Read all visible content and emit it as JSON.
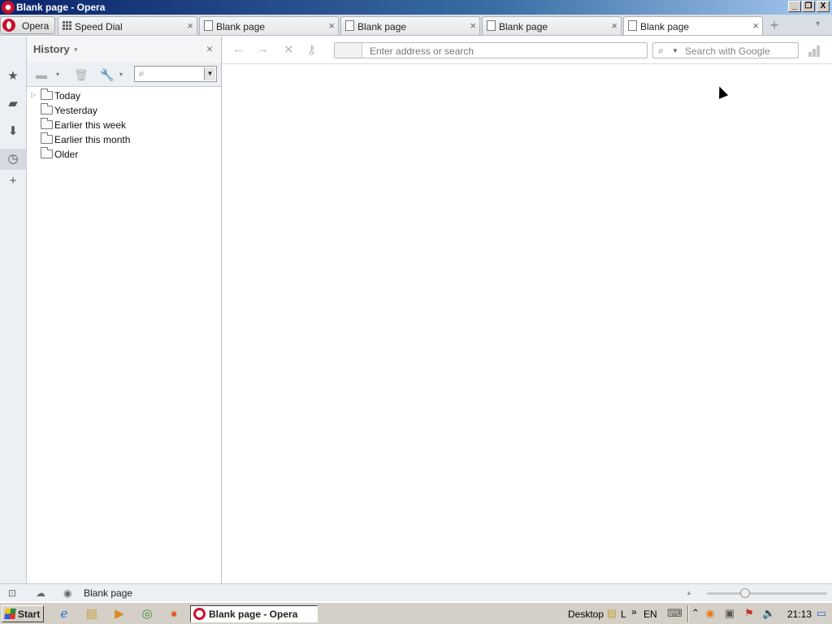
{
  "window": {
    "title": "Blank page - Opera",
    "buttons": [
      "_",
      "❐",
      "X"
    ]
  },
  "tabstrip": {
    "menu_label": "Opera",
    "tabs": [
      {
        "label": "Speed Dial",
        "icon": "speed-dial-grid-icon",
        "active": false
      },
      {
        "label": "Blank page",
        "icon": "page-icon",
        "active": false
      },
      {
        "label": "Blank page",
        "icon": "page-icon",
        "active": false
      },
      {
        "label": "Blank page",
        "icon": "page-icon",
        "active": true
      },
      {
        "label": "Blank page",
        "icon": "page-icon",
        "active": false
      }
    ],
    "close_glyph": "×",
    "new_tab_glyph": "+",
    "tab_menu_glyph": "▾"
  },
  "panelbar": {
    "items": [
      {
        "name": "bookmarks-star-icon",
        "glyph": "★"
      },
      {
        "name": "notes-icon",
        "glyph": "▰"
      },
      {
        "name": "downloads-icon",
        "glyph": "⬇"
      },
      {
        "name": "history-clock-icon",
        "glyph": "◷"
      },
      {
        "name": "add-panel-icon",
        "glyph": "+"
      }
    ]
  },
  "history": {
    "title": "History",
    "title_caret": "▾",
    "close_glyph": "×",
    "search_placeholder": "",
    "folders": [
      {
        "label": "Today",
        "expandable": true
      },
      {
        "label": "Yesterday",
        "expandable": false
      },
      {
        "label": "Earlier this week",
        "expandable": false
      },
      {
        "label": "Earlier this month",
        "expandable": false
      },
      {
        "label": "Older",
        "expandable": false
      }
    ]
  },
  "navbar": {
    "back_glyph": "←",
    "forward_glyph": "→",
    "stop_glyph": "✕",
    "key_glyph": "⚷",
    "address_placeholder": "Enter address or search",
    "search_placeholder": "Search with Google"
  },
  "statusbar": {
    "page_text": "Blank page",
    "zoom_level": 0.3
  },
  "taskbar": {
    "start_label": "Start",
    "task_label": "Blank page - Opera",
    "desktop_label": "Desktop",
    "lang": "EN",
    "clock": "21:13",
    "chevron": "»",
    "truncated_label": "L"
  }
}
